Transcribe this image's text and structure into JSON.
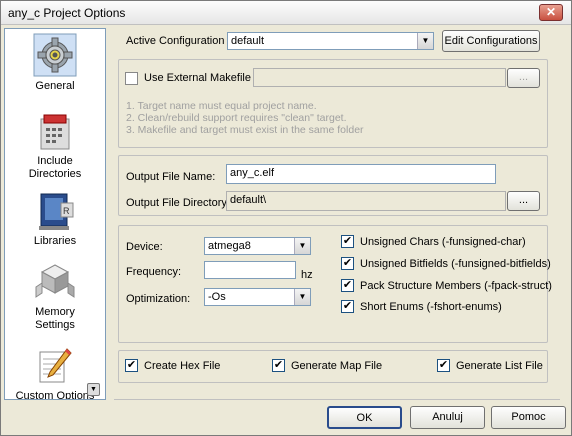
{
  "window": {
    "title": "any_c Project Options",
    "close_label": "✕"
  },
  "sidebar": {
    "items": [
      {
        "label_line1": "General",
        "label_line2": ""
      },
      {
        "label_line1": "Include",
        "label_line2": "Directories"
      },
      {
        "label_line1": "Libraries",
        "label_line2": ""
      },
      {
        "label_line1": "Memory",
        "label_line2": "Settings"
      },
      {
        "label_line1": "Custom Options",
        "label_line2": ""
      }
    ],
    "scroll_down_glyph": "▼"
  },
  "config": {
    "active_label": "Active Configuration",
    "active_value": "default",
    "edit_button": "Edit Configurations"
  },
  "makefile": {
    "checkbox_label": "Use External Makefile",
    "checked": false,
    "path_value": "",
    "browse_button": "...",
    "notes": [
      "1. Target name must equal project name.",
      "2. Clean/rebuild support requires  \"clean\" target.",
      "3. Makefile and target must exist in the same folder"
    ]
  },
  "output": {
    "file_name_label": "Output File Name:",
    "file_name_value": "any_c.elf",
    "directory_label": "Output File Directory:",
    "directory_value": "default\\",
    "browse_button": "..."
  },
  "device": {
    "device_label": "Device:",
    "device_value": "atmega8",
    "frequency_label": "Frequency:",
    "frequency_value": "",
    "frequency_unit": "hz",
    "optimization_label": "Optimization:",
    "optimization_value": "-Os",
    "options": [
      {
        "label": "Unsigned Chars (-funsigned-char)",
        "checked": true
      },
      {
        "label": "Unsigned Bitfields (-funsigned-bitfields)",
        "checked": true
      },
      {
        "label": "Pack Structure Members (-fpack-struct)",
        "checked": true
      },
      {
        "label": "Short Enums (-fshort-enums)",
        "checked": true
      }
    ]
  },
  "outputs": {
    "hex_label": "Create Hex File",
    "hex_checked": true,
    "map_label": "Generate Map File",
    "map_checked": true,
    "list_label": "Generate List File",
    "list_checked": true
  },
  "buttons": {
    "ok": "OK",
    "cancel": "Anuluj",
    "help": "Pomoc"
  },
  "check_glyph": "✔"
}
